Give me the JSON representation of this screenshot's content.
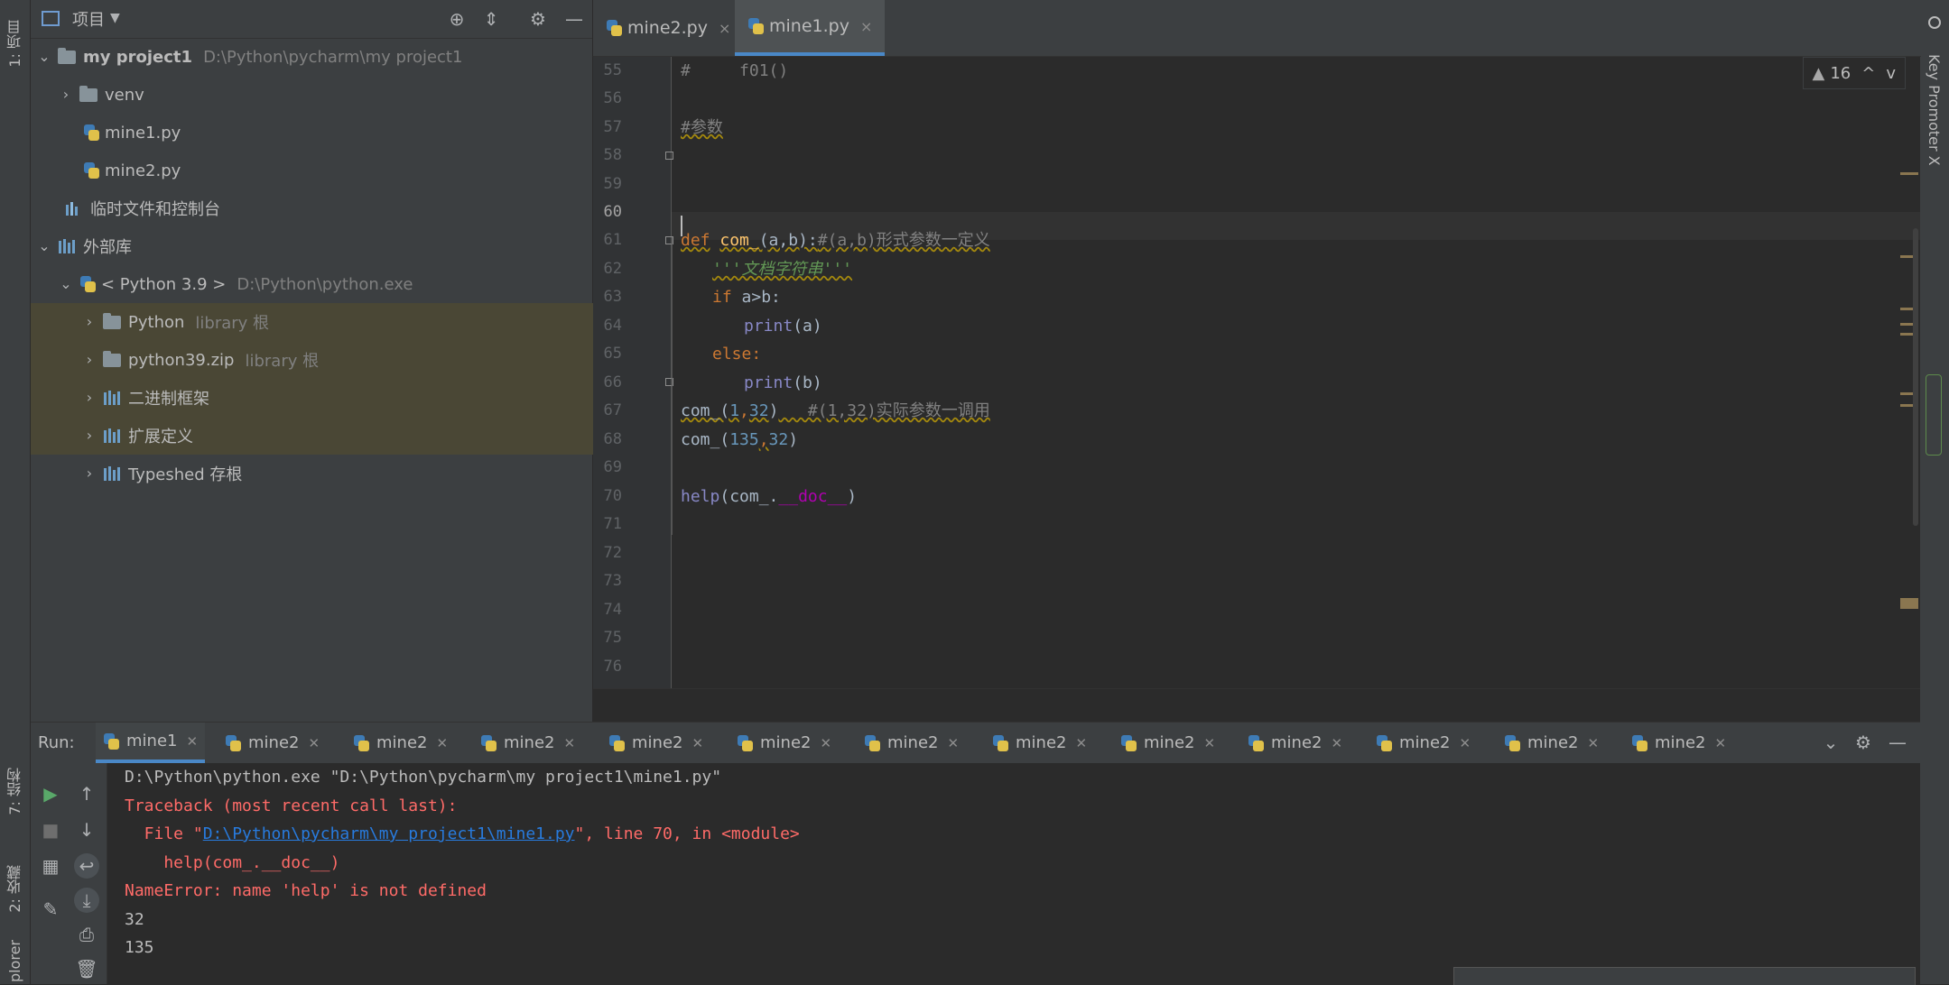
{
  "left_strip": {
    "project_tab": "1: 项目",
    "structure_tab": "7: 结构",
    "favorites_tab": "2: 收藏",
    "explorer_tab": "plorer"
  },
  "right_strip": {
    "key_promoter": "Key Promoter X"
  },
  "project_panel": {
    "title": "项目",
    "tree": [
      {
        "name": "my project1",
        "path": "D:\\Python\\pycharm\\my project1"
      },
      {
        "name": "venv"
      },
      {
        "name": "mine1.py"
      },
      {
        "name": "mine2.py"
      },
      {
        "name": "临时文件和控制台"
      },
      {
        "name": "外部库"
      },
      {
        "name": "< Python 3.9 >",
        "path": "D:\\Python\\python.exe"
      },
      {
        "name": "Python",
        "path": "library 根"
      },
      {
        "name": "python39.zip",
        "path": "library 根"
      },
      {
        "name": "二进制框架"
      },
      {
        "name": "扩展定义"
      },
      {
        "name": "Typeshed 存根"
      }
    ]
  },
  "editor_tabs": [
    {
      "label": "mine2.py",
      "close": "×"
    },
    {
      "label": "mine1.py",
      "close": "×"
    }
  ],
  "editor": {
    "line_numbers": [
      "55",
      "56",
      "57",
      "58",
      "59",
      "60",
      "61",
      "62",
      "63",
      "64",
      "65",
      "66",
      "67",
      "68",
      "69",
      "70",
      "71",
      "72",
      "73",
      "74",
      "75",
      "76"
    ],
    "inspection": {
      "icon": "warning-triangle",
      "count": "16",
      "up": "^",
      "down": "v"
    },
    "code": {
      "l55_hash": "#",
      "l55_rest": "     f01()",
      "l57": "#参数",
      "l61_def": "def",
      "l61_name": "com_",
      "l61_params": "(a,b):",
      "l61_comment": "#(a,b)形式参数一定义",
      "l62": "'''文档字符串'''",
      "l63_if": "if",
      "l63_rest": " a>b:",
      "l64_print": "print",
      "l64_rest": "(a)",
      "l65": "else:",
      "l66_print": "print",
      "l66_rest": "(b)",
      "l67_call": "com_(",
      "l67_n1": "1",
      "l67_comma": ",",
      "l67_n2": "32",
      "l67_close": ")",
      "l67_comment": "   #(1,32)实际参数一调用",
      "l68_call": "com_(",
      "l68_n1": "135",
      "l68_comma": ",",
      "l68_n2": "32",
      "l68_close": ")",
      "l70_help": "help",
      "l70_open": "(com_.",
      "l70_doc": "__doc__",
      "l70_close": ")"
    }
  },
  "run_panel": {
    "label": "Run:",
    "tabs": [
      "mine1",
      "mine2",
      "mine2",
      "mine2",
      "mine2",
      "mine2",
      "mine2",
      "mine2",
      "mine2",
      "mine2",
      "mine2",
      "mine2",
      "mine2"
    ],
    "console": {
      "cmd": "D:\\Python\\python.exe \"D:\\Python\\pycharm\\my project1\\mine1.py\"",
      "tb1": "Traceback (most recent call last):",
      "tb2_pre": "  File \"",
      "tb2_link": "D:\\Python\\pycharm\\my project1\\mine1.py",
      "tb2_post": "\", line 70, in <module>",
      "tb3": "    help(com_.__doc__)",
      "tb4": "NameError: name 'help' is not defined",
      "out1": "32",
      "out2": "135"
    }
  },
  "colors": {
    "accent": "#4a88c7",
    "error": "#ff6b68",
    "library_highlight": "#4a4735"
  }
}
